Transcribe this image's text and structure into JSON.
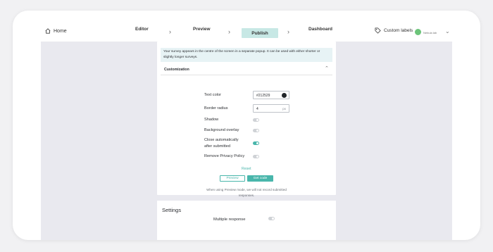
{
  "nav": {
    "home": "Home",
    "steps": [
      "Editor",
      "Preview",
      "Publish",
      "Dashboard"
    ],
    "active_step": "Publish",
    "custom_labels": "Custom labels",
    "user": "Nebula lab"
  },
  "info_text": "Your survey appears in the centre of the screen in a separate popup. It can be used with either shorter or slightly longer surveys.",
  "customization": {
    "title": "Customization",
    "text_color_label": "Text color",
    "text_color_value": "#212529",
    "border_radius_label": "Border radius",
    "border_radius_value": "4",
    "border_radius_unit": "px",
    "shadow_label": "Shadow",
    "background_overlay_label": "Background overlay",
    "close_auto_label_1": "Close automatically",
    "close_auto_label_2": "after submitted",
    "remove_privacy_label": "Remove Privacy Policy",
    "reset": "Reset",
    "preview_button": "Preview",
    "get_code_button": "Get code",
    "note": "When using Preview mode, we will not record submitted responses.",
    "toggles": {
      "shadow": false,
      "background_overlay": false,
      "close_automatically": true,
      "remove_privacy": false
    }
  },
  "settings": {
    "title": "Settings",
    "multiple_response": "Multiple response"
  },
  "colors": {
    "accent": "#49b6ab",
    "active_step_bg": "#c7e8e5",
    "avatar": "#6cc47a"
  }
}
